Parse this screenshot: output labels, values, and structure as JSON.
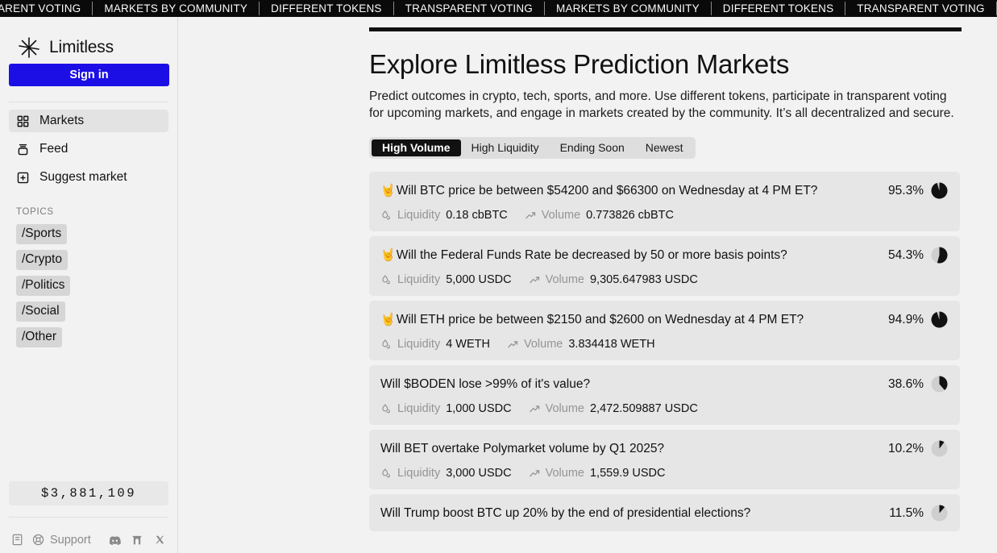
{
  "marquee": {
    "items": [
      "TRANSPARENT VOTING",
      "MARKETS BY COMMUNITY",
      "DIFFERENT TOKENS",
      "TRANSPARENT VOTING",
      "MARKETS BY COMMUNITY",
      "DIFFERENT TOKENS",
      "TRANSPARENT VOTING",
      "MARKETS BY COMMUNITY",
      "DIFFERENT TOKENS"
    ]
  },
  "sidebar": {
    "brand": "Limitless",
    "sign_in_label": "Sign in",
    "nav": [
      {
        "label": "Markets",
        "icon": "grid-icon",
        "active": true
      },
      {
        "label": "Feed",
        "icon": "feed-icon",
        "active": false
      },
      {
        "label": "Suggest market",
        "icon": "plus-square-icon",
        "active": false
      }
    ],
    "topics_title": "TOPICS",
    "topics": [
      "/Sports",
      "/Crypto",
      "/Politics",
      "/Social",
      "/Other"
    ],
    "volume_amount": "$3,881,109",
    "footer": {
      "support_label": "Support",
      "docs_icon": "book-icon",
      "support_icon": "lifebuoy-icon",
      "socials": [
        "discord-icon",
        "farcaster-icon",
        "x-icon"
      ]
    }
  },
  "main": {
    "title": "Explore Limitless Prediction Markets",
    "subtitle": "Predict outcomes in crypto, tech, sports, and more. Use different tokens, participate in transparent voting for upcoming markets, and engage in markets created by the community. It’s all decentralized and secure.",
    "tabs": [
      {
        "label": "High Volume",
        "active": true
      },
      {
        "label": "High Liquidity",
        "active": false
      },
      {
        "label": "Ending Soon",
        "active": false
      },
      {
        "label": "Newest",
        "active": false
      }
    ],
    "meta_labels": {
      "liquidity": "Liquidity",
      "volume": "Volume"
    },
    "markets": [
      {
        "emoji": "🤘",
        "title": "Will BTC price be between $54200 and $66300 on Wednesday at 4 PM ET?",
        "percent": "95.3%",
        "percent_value": 95.3,
        "liquidity": "0.18 cbBTC",
        "volume": "0.773826 cbBTC"
      },
      {
        "emoji": "🤘",
        "title": "Will the Federal Funds Rate be decreased by 50 or more basis points?",
        "percent": "54.3%",
        "percent_value": 54.3,
        "liquidity": "5,000 USDC",
        "volume": "9,305.647983 USDC"
      },
      {
        "emoji": "🤘",
        "title": "Will ETH price be between $2150 and $2600 on Wednesday at 4 PM ET?",
        "percent": "94.9%",
        "percent_value": 94.9,
        "liquidity": "4 WETH",
        "volume": "3.834418 WETH"
      },
      {
        "emoji": "",
        "title": "Will $BODEN lose >99% of it's value?",
        "percent": "38.6%",
        "percent_value": 38.6,
        "liquidity": "1,000 USDC",
        "volume": "2,472.509887 USDC"
      },
      {
        "emoji": "",
        "title": "Will BET overtake Polymarket volume by Q1 2025?",
        "percent": "10.2%",
        "percent_value": 10.2,
        "liquidity": "3,000 USDC",
        "volume": "1,559.9 USDC"
      },
      {
        "emoji": "",
        "title": "Will Trump boost BTC up 20% by the end of presidential elections?",
        "percent": "11.5%",
        "percent_value": 11.5,
        "liquidity": "",
        "volume": ""
      }
    ]
  },
  "colors": {
    "accent": "#1c0fe6",
    "background": "#f2f2f2",
    "card": "#e6e6e6",
    "text": "#111111",
    "muted": "#949494",
    "marquee_bg": "#0a0a0a"
  }
}
